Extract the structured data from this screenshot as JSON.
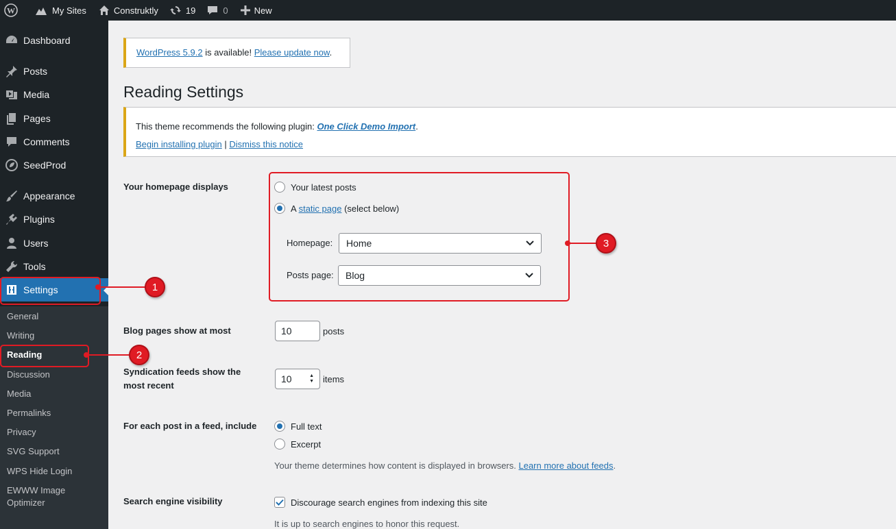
{
  "adminbar": {
    "my_sites": "My Sites",
    "site_name": "Construktly",
    "updates_count": "19",
    "comments_count": "0",
    "new_label": "New"
  },
  "sidebar": {
    "items": [
      {
        "label": "Dashboard",
        "icon": "dashboard-icon"
      },
      {
        "label": "Posts",
        "icon": "pin-icon"
      },
      {
        "label": "Media",
        "icon": "media-icon"
      },
      {
        "label": "Pages",
        "icon": "pages-icon"
      },
      {
        "label": "Comments",
        "icon": "comment-icon"
      },
      {
        "label": "SeedProd",
        "icon": "seedprod-icon"
      },
      {
        "label": "Appearance",
        "icon": "brush-icon"
      },
      {
        "label": "Plugins",
        "icon": "plugin-icon"
      },
      {
        "label": "Users",
        "icon": "users-icon"
      },
      {
        "label": "Tools",
        "icon": "wrench-icon"
      },
      {
        "label": "Settings",
        "icon": "settings-icon"
      }
    ],
    "submenu": [
      "General",
      "Writing",
      "Reading",
      "Discussion",
      "Media",
      "Permalinks",
      "Privacy",
      "SVG Support",
      "WPS Hide Login",
      "EWWW Image",
      "Optimizer"
    ]
  },
  "update_notice": {
    "version_link": "WordPress 5.9.2",
    "middle": " is available! ",
    "update_link": "Please update now",
    "end": "."
  },
  "page_title": "Reading Settings",
  "plugin_notice": {
    "text": "This theme recommends the following plugin: ",
    "plugin": "One Click Demo Import",
    "period": ".",
    "install_link": "Begin installing plugin",
    "separator": " | ",
    "dismiss_link": "Dismiss this notice"
  },
  "homepage_displays": {
    "label": "Your homepage displays",
    "opt_latest": "Your latest posts",
    "opt_static_a": "A ",
    "opt_static_link": "static page",
    "opt_static_b": " (select below)",
    "homepage_label": "Homepage:",
    "homepage_value": "Home",
    "posts_label": "Posts page:",
    "posts_value": "Blog"
  },
  "blog_pages": {
    "label": "Blog pages show at most",
    "value": "10",
    "unit": "posts"
  },
  "syndication": {
    "label": "Syndication feeds show the most recent",
    "value": "10",
    "unit": "items"
  },
  "feed_include": {
    "label": "For each post in a feed, include",
    "opt_full": "Full text",
    "opt_excerpt": "Excerpt",
    "desc": "Your theme determines how content is displayed in browsers. ",
    "desc_link": "Learn more about feeds",
    "desc_end": "."
  },
  "search_visibility": {
    "label": "Search engine visibility",
    "checkbox_label": "Discourage search engines from indexing this site",
    "desc": "It is up to search engines to honor this request."
  },
  "annotations": [
    "1",
    "2",
    "3"
  ]
}
